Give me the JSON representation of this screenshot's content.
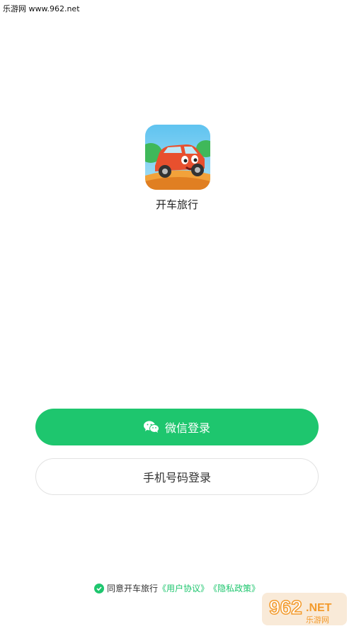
{
  "watermark": {
    "top_text": "乐游网 www.962.net",
    "brand_number": "962",
    "brand_suffix": ".NET",
    "brand_sub": "乐游网"
  },
  "app": {
    "name": "开车旅行"
  },
  "buttons": {
    "wechat_label": "微信登录",
    "phone_label": "手机号码登录"
  },
  "agreement": {
    "prefix": "同意开车旅行",
    "user_agreement": "《用户协议》",
    "privacy_policy": "《隐私政策》"
  },
  "colors": {
    "primary": "#1ec66e",
    "background": "#ffffff"
  },
  "icons": {
    "wechat": "wechat-icon",
    "check": "check-circle-icon",
    "logo": "car-logo-icon"
  }
}
